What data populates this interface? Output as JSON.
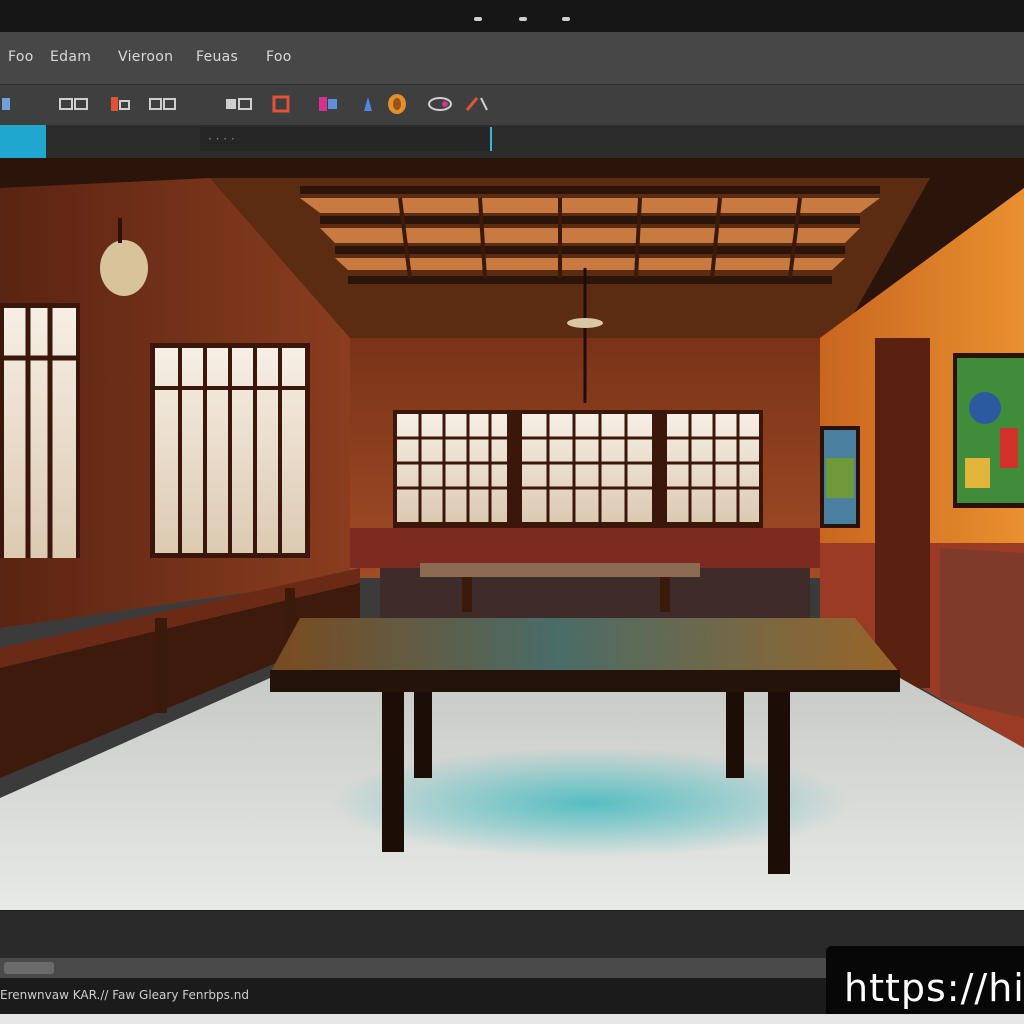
{
  "menubar": {
    "items": [
      {
        "label": "Foo"
      },
      {
        "label": "Edam"
      },
      {
        "label": "Vieroon"
      },
      {
        "label": "Feuas"
      },
      {
        "label": "Foo"
      }
    ]
  },
  "toolbar": {
    "tools": [
      {
        "label": "¤",
        "icon": "move-tool-icon"
      },
      {
        "label": "ɴ▫",
        "icon": "marquee-tool-icon"
      },
      {
        "label": "⬚",
        "icon": "lasso-tool-icon",
        "color": "#e2523a"
      },
      {
        "label": "ʀ▫",
        "icon": "crop-tool-icon"
      },
      {
        "label": "⬚",
        "icon": "heal-tool-icon"
      },
      {
        "label": "⬚",
        "icon": "brush-tool-icon",
        "color": "#e2523a"
      },
      {
        "label": "⬚",
        "icon": "stamp-tool-icon",
        "color": "#d4338b"
      },
      {
        "label": "⬚",
        "icon": "eraser-tool-icon",
        "color": "#4f86e0"
      },
      {
        "label": "⬚",
        "icon": "gradient-tool-icon",
        "color": "#e0912c"
      },
      {
        "label": "⬚",
        "icon": "dodge-tool-icon"
      },
      {
        "label": "⬚",
        "icon": "pen-tool-icon",
        "color": "#d4338b"
      }
    ]
  },
  "options": {
    "path_text": "·  ·  ·  ·"
  },
  "status": {
    "text": "Erenwnvaw KAR.// Faw Gleary Fenrbps.nd"
  },
  "overlay": {
    "url": "https://hi"
  },
  "colors": {
    "accent": "#1fa7cf",
    "wall": "#a5502c",
    "floor": "#d6d9d6",
    "table_top": "#8d5b27"
  }
}
